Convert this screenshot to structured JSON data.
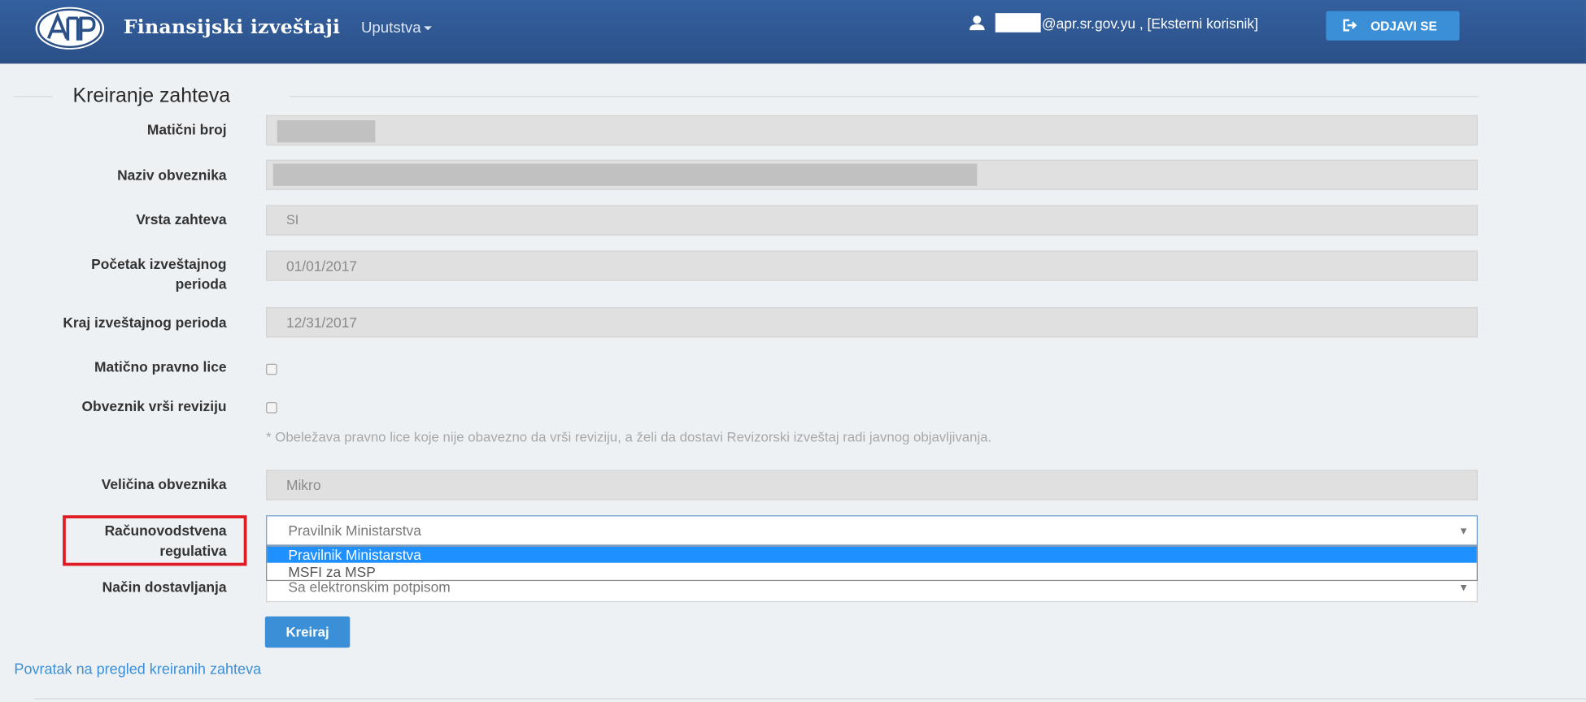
{
  "header": {
    "logo_text": "АПР",
    "brand": "Finansijski izveštaji",
    "menu_label": "Uputstva",
    "user_email": "@apr.sr.gov.yu , [Eksterni korisnik]",
    "logout_label": "ODJAVI SE"
  },
  "form": {
    "legend": "Kreiranje zahteva",
    "fields": {
      "maticni_broj": {
        "label": "Matični broj",
        "value": ""
      },
      "naziv_obveznika": {
        "label": "Naziv obveznika",
        "value": ""
      },
      "vrsta_zahteva": {
        "label": "Vrsta zahteva",
        "value": "SI"
      },
      "pocetak": {
        "label_line1": "Početak izveštajnog",
        "label_line2": "perioda",
        "value": "01/01/2017"
      },
      "kraj": {
        "label": "Kraj izveštajnog perioda",
        "value": "12/31/2017"
      },
      "maticno_pravno_lice": {
        "label": "Matično pravno lice",
        "checked": false
      },
      "vrsi_reviziju": {
        "label": "Obveznik vrši reviziju",
        "checked": false
      },
      "revizija_note": "* Obeležava pravno lice koje nije obavezno da vrši reviziju, a želi da dostavi Revizorski izveštaj radi javnog objavljivanja.",
      "velicina": {
        "label": "Veličina obveznika",
        "value": "Mikro"
      },
      "regulativa": {
        "label_line1": "Računovodstvena",
        "label_line2": "regulativa",
        "value": "Pravilnik Ministarstva",
        "options": [
          "Pravilnik Ministarstva",
          "MSFI za MSP"
        ]
      },
      "nacin": {
        "label": "Način dostavljanja",
        "value": "Sa elektronskim potpisom"
      }
    },
    "submit_label": "Kreiraj",
    "back_link": "Povratak na pregled kreiranih zahteva"
  },
  "colors": {
    "navbar": "#2e5591",
    "accent": "#3b8fd6",
    "highlight_box": "#e11b22",
    "selected_option": "#1e90ff"
  }
}
